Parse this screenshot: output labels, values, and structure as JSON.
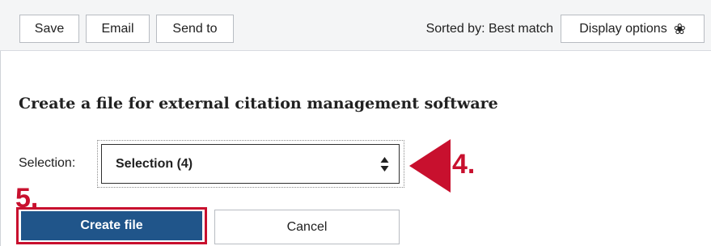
{
  "toolbar": {
    "save_label": "Save",
    "email_label": "Email",
    "send_to_label": "Send to",
    "sorted_by_text": "Sorted by: Best match",
    "display_options_label": "Display options",
    "display_options_icon": "gear-icon"
  },
  "panel": {
    "heading": "Create a file for external citation management software",
    "selection_label": "Selection:",
    "selection_value": "Selection (4)",
    "select_icon": "up-down-arrows-icon",
    "create_label": "Create file",
    "cancel_label": "Cancel"
  },
  "callouts": {
    "step_4": "4.",
    "step_5": "5.",
    "color": "#c8102e"
  },
  "colors": {
    "primary_button": "#20558a",
    "toolbar_bg": "#f4f5f6"
  }
}
